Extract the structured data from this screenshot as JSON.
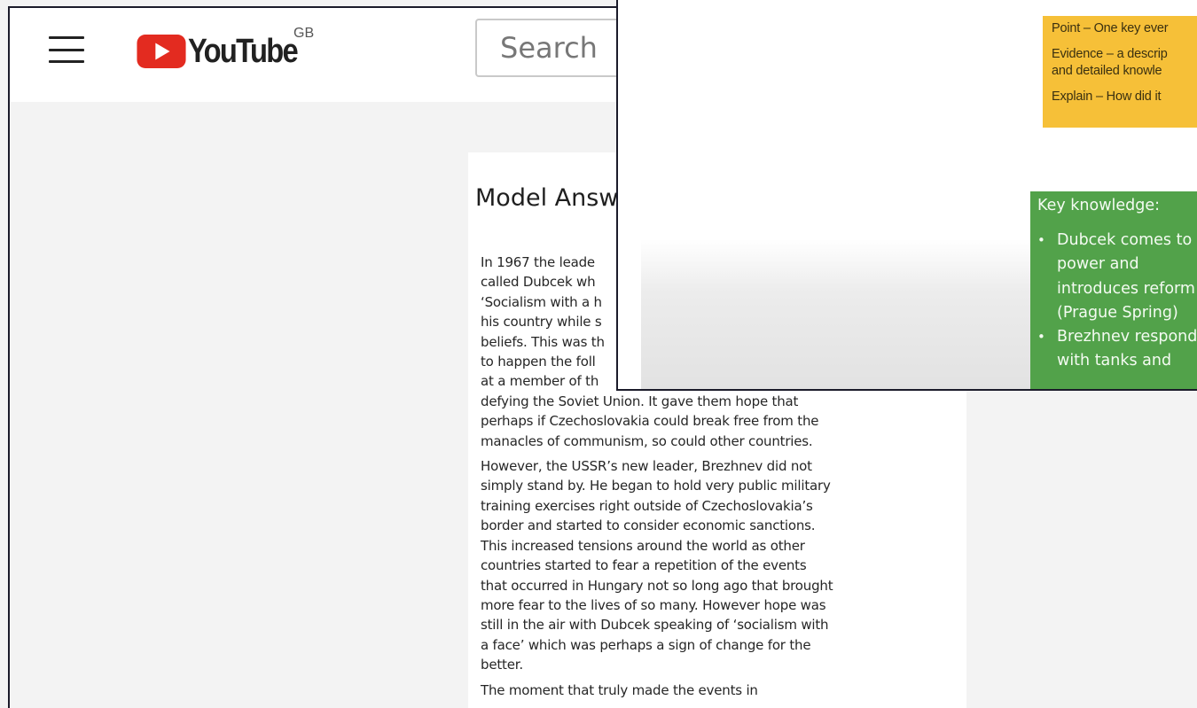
{
  "youtube": {
    "logo_text": "YouTube",
    "region": "GB",
    "search_placeholder": "Search"
  },
  "document": {
    "title": "Model Answ",
    "para1": [
      " In 1967 the leade",
      "called Dubcek wh",
      "‘Socialism with a h",
      "his country while s",
      "beliefs. This was th",
      "to happen the foll",
      "at a member of th",
      "defying the Soviet Union. It gave them hope that",
      "perhaps if Czechoslovakia could break free from the",
      "manacles of communism, so could other countries."
    ],
    "para2": [
      "However, the USSR’s new leader, Brezhnev did not",
      "simply stand by. He began to hold very public military",
      "training exercises right outside of Czechoslovakia’s",
      "border and started to consider economic sanctions.",
      "This increased tensions around the world as other",
      "countries started to fear a repetition of the events",
      "that occurred in Hungary not so long ago that brought",
      "more fear to the lives of so many. However hope was",
      "still in the air with Dubcek speaking of ‘socialism with",
      "a face’ which was perhaps a sign of change for the",
      "better."
    ],
    "para3": [
      "The moment that truly made the events in"
    ]
  },
  "slide": {
    "yellow": {
      "point": "Point – One key ever",
      "evidence_1": "Evidence – a descrip",
      "evidence_2": "and detailed knowle",
      "explain": "Explain – How did it"
    },
    "green": {
      "title": "Key knowledge:",
      "bullets": [
        [
          "Dubcek comes to",
          "power and",
          "introduces reform",
          "(Prague Spring)"
        ],
        [
          "Brezhnev respond",
          "with tanks and"
        ]
      ]
    }
  }
}
